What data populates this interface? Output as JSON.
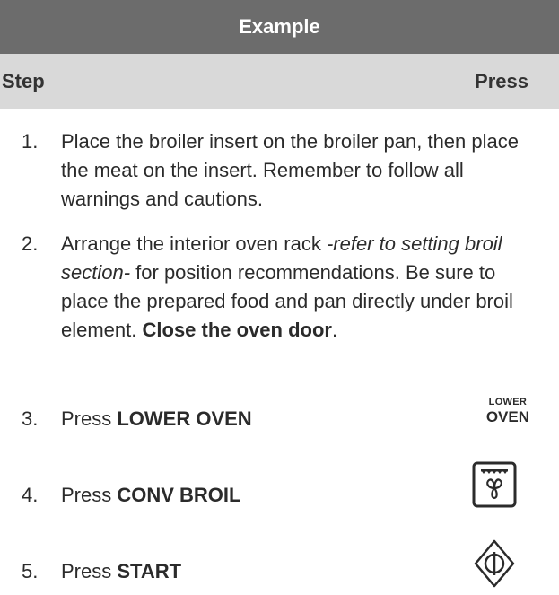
{
  "title": "Example",
  "header": {
    "step": "Step",
    "press": "Press"
  },
  "steps": [
    {
      "num": "1.",
      "parts": [
        {
          "t": "Place the broiler insert on the broiler pan, then place the meat on the insert. Remember to follow all warnings and cautions."
        }
      ]
    },
    {
      "num": "2.",
      "parts": [
        {
          "t": "Arrange the interior oven rack "
        },
        {
          "t": "-refer to setting broil section-",
          "i": true
        },
        {
          "t": " for position recommendations. Be sure to place the prepared food and pan directly under broil element. "
        },
        {
          "t": "Close the oven door",
          "b": true
        },
        {
          "t": "."
        }
      ]
    },
    {
      "num": "3.",
      "parts": [
        {
          "t": "Press "
        },
        {
          "t": "LOWER OVEN",
          "b": true
        }
      ]
    },
    {
      "num": "4.",
      "parts": [
        {
          "t": "Press "
        },
        {
          "t": "CONV BROIL",
          "b": true
        }
      ]
    },
    {
      "num": "5.",
      "parts": [
        {
          "t": "Press "
        },
        {
          "t": "START",
          "b": true
        }
      ]
    }
  ],
  "press_labels": {
    "lower_oven_small": "LOWER",
    "lower_oven_big": "OVEN"
  },
  "icons": {
    "conv_broil": "conv-broil-icon",
    "start": "start-icon"
  }
}
